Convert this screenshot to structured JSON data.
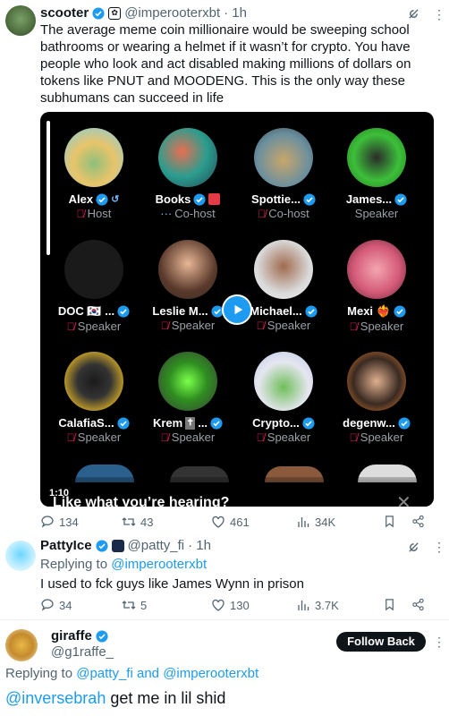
{
  "colors": {
    "accent": "#1d9bf0",
    "text": "#0f1419",
    "muted": "#536471",
    "mic_off": "#e0245e"
  },
  "tweet1": {
    "name": "scooter",
    "handle": "@imperooterxbt",
    "time": "· 1h",
    "text": "The average meme coin millionaire would be sweeping school bathrooms or wearing a helmet if it wasn’t for crypto. You have people who look and act disabled making millions of dollars on tokens like PNUT and MOODENG. This is the only way these subhumans can succeed in life",
    "media": {
      "time": "1:10",
      "caption": "Like what you’re hearing?",
      "speakers": [
        {
          "name": "Alex",
          "role": "Host"
        },
        {
          "name": "Books",
          "role": "Co-host"
        },
        {
          "name": "Spottie...",
          "role": "Co-host"
        },
        {
          "name": "James...",
          "role": "Speaker"
        },
        {
          "name": "DOC 🇰🇷 ...",
          "role": "Speaker"
        },
        {
          "name": "Leslie M...",
          "role": "Speaker"
        },
        {
          "name": "Michael...",
          "role": "Speaker"
        },
        {
          "name": "Mexi ❤️‍🔥",
          "role": "Speaker"
        },
        {
          "name": "CalafiaS...",
          "role": "Speaker"
        },
        {
          "name": "Krem",
          "role": "Speaker"
        },
        {
          "name": "Crypto...",
          "role": "Speaker"
        },
        {
          "name": "degenw...",
          "role": "Speaker"
        }
      ]
    },
    "actions": {
      "replies": "134",
      "retweets": "43",
      "likes": "461",
      "views": "34K"
    }
  },
  "tweet2": {
    "name": "PattyIce",
    "handle": "@patty_fi",
    "time": "· 1h",
    "replying_label": "Replying to",
    "replying_to": "@imperooterxbt",
    "text": "I used to fck guys like James Wynn in prison",
    "actions": {
      "replies": "34",
      "retweets": "5",
      "likes": "130",
      "views": "3.7K"
    }
  },
  "tweet3": {
    "name": "giraffe",
    "handle": "@g1raffe_",
    "follow_label": "Follow Back",
    "replying_label": "Replying to",
    "replying_to_1": "@patty_fi",
    "replying_and": "and",
    "replying_to_2": "@imperooterxbt",
    "mention": "@inversebrah",
    "text": " get me in lil shid"
  }
}
